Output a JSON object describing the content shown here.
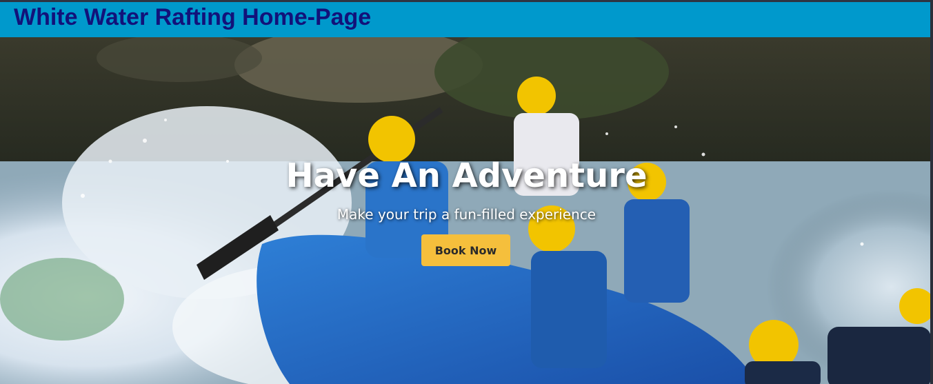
{
  "header": {
    "title": "White Water Rafting Home-Page"
  },
  "hero": {
    "heading": "Have An Adventure",
    "subheading": "Make your trip a fun-filled experience",
    "cta_label": "Book Now",
    "image_subject": "rafters-in-whitewater-photo"
  },
  "colors": {
    "header_bg": "#0099cc",
    "header_text": "#12127a",
    "cta_bg": "#f5bf3c",
    "cta_text": "#2a2a2a"
  }
}
